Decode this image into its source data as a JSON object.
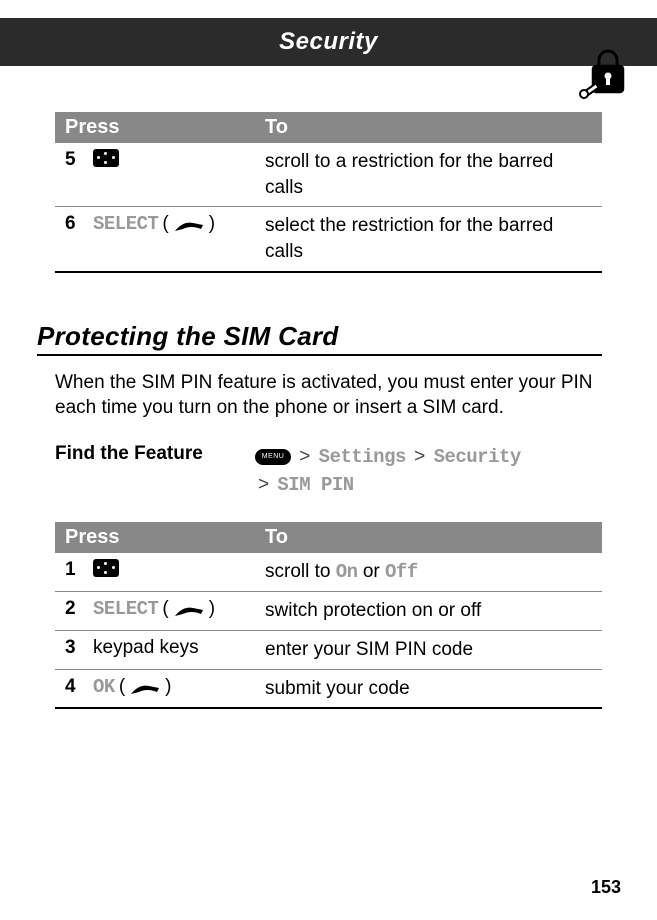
{
  "header": {
    "title": "Security"
  },
  "table1": {
    "header_press": "Press",
    "header_to": "To",
    "rows": [
      {
        "num": "5",
        "press_type": "nav",
        "to": "scroll to a restriction for the barred calls"
      },
      {
        "num": "6",
        "press_type": "softkey",
        "press_label": "SELECT",
        "to": "select the restriction for the barred calls"
      }
    ]
  },
  "section": {
    "heading": "Protecting the SIM Card",
    "body": "When the SIM PIN feature is activated, you must enter your PIN each time you turn on the phone or insert a SIM card."
  },
  "find_feature": {
    "label": "Find the Feature",
    "path1a": "Settings",
    "path1b": "Security",
    "path2": "SIM PIN"
  },
  "table2": {
    "header_press": "Press",
    "header_to": "To",
    "rows": [
      {
        "num": "1",
        "press_type": "nav",
        "to_prefix": "scroll to ",
        "opt1": "On",
        "mid": " or ",
        "opt2": "Off"
      },
      {
        "num": "2",
        "press_type": "softkey",
        "press_label": "SELECT",
        "to": "switch protection on or off"
      },
      {
        "num": "3",
        "press_type": "text",
        "press_text": "keypad keys",
        "to": "enter your SIM PIN code"
      },
      {
        "num": "4",
        "press_type": "softkey",
        "press_label": "OK",
        "to": "submit your code"
      }
    ]
  },
  "page_number": "153",
  "menu_text": "MENU"
}
